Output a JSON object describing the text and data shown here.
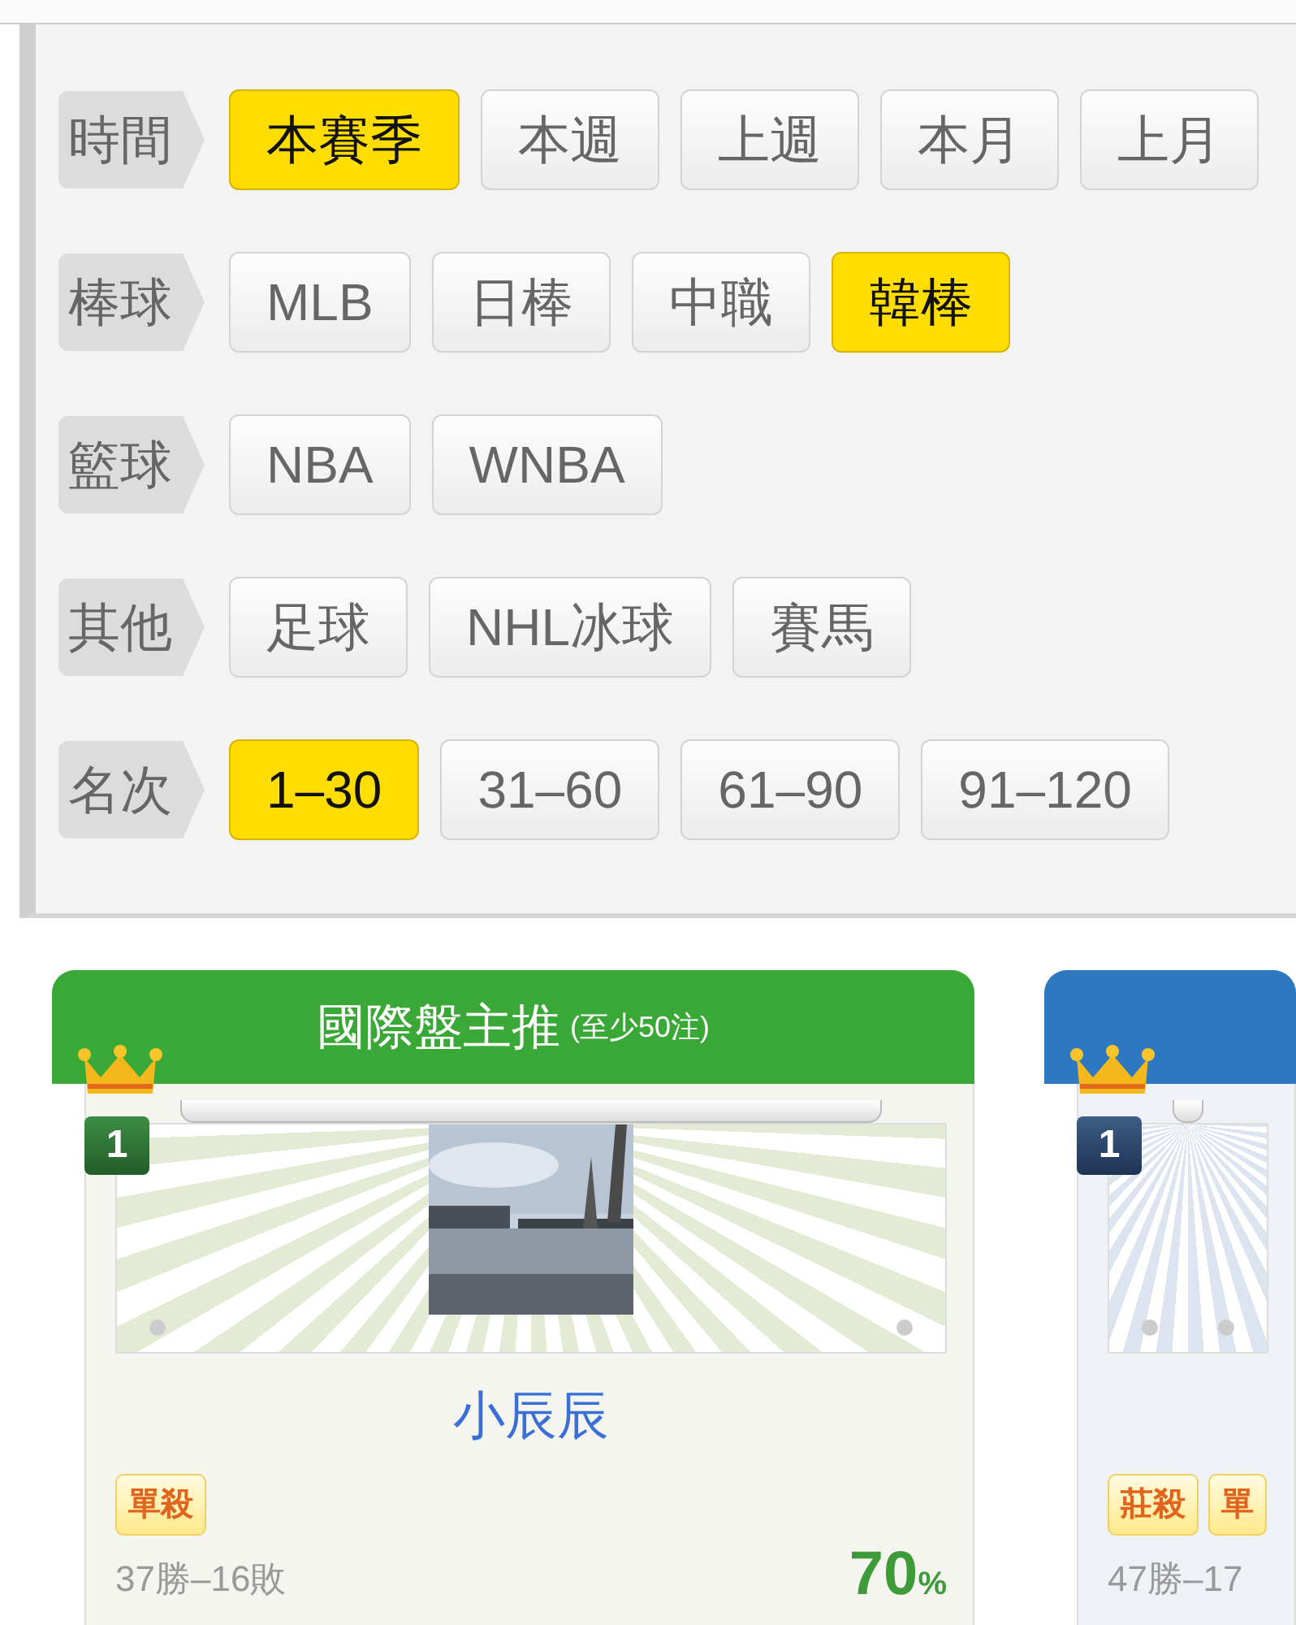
{
  "filters": [
    {
      "label": "時間",
      "options": [
        {
          "text": "本賽季",
          "selected": true
        },
        {
          "text": "本週",
          "selected": false
        },
        {
          "text": "上週",
          "selected": false
        },
        {
          "text": "本月",
          "selected": false
        },
        {
          "text": "上月",
          "selected": false
        }
      ]
    },
    {
      "label": "棒球",
      "options": [
        {
          "text": "MLB",
          "selected": false
        },
        {
          "text": "日棒",
          "selected": false
        },
        {
          "text": "中職",
          "selected": false
        },
        {
          "text": "韓棒",
          "selected": true
        }
      ]
    },
    {
      "label": "籃球",
      "options": [
        {
          "text": "NBA",
          "selected": false
        },
        {
          "text": "WNBA",
          "selected": false
        }
      ]
    },
    {
      "label": "其他",
      "options": [
        {
          "text": "足球",
          "selected": false
        },
        {
          "text": "NHL冰球",
          "selected": false
        },
        {
          "text": "賽馬",
          "selected": false
        }
      ]
    },
    {
      "label": "名次",
      "options": [
        {
          "text": "1–30",
          "selected": true
        },
        {
          "text": "31–60",
          "selected": false
        },
        {
          "text": "61–90",
          "selected": false
        },
        {
          "text": "91–120",
          "selected": false
        }
      ]
    }
  ],
  "cards": [
    {
      "color": "#3aa836",
      "title": "國際盤主推",
      "title_note": "(至少50注)",
      "rank": "1",
      "photo": {
        "kind": "picture"
      },
      "name": "小辰辰",
      "tags": [
        "單殺"
      ],
      "record": "37勝–16敗",
      "rate": "70",
      "rate_unit": "%"
    },
    {
      "color": "#2d78c0",
      "rank": "1",
      "tags": [
        "莊殺",
        "單"
      ],
      "record": "47勝–17"
    }
  ]
}
